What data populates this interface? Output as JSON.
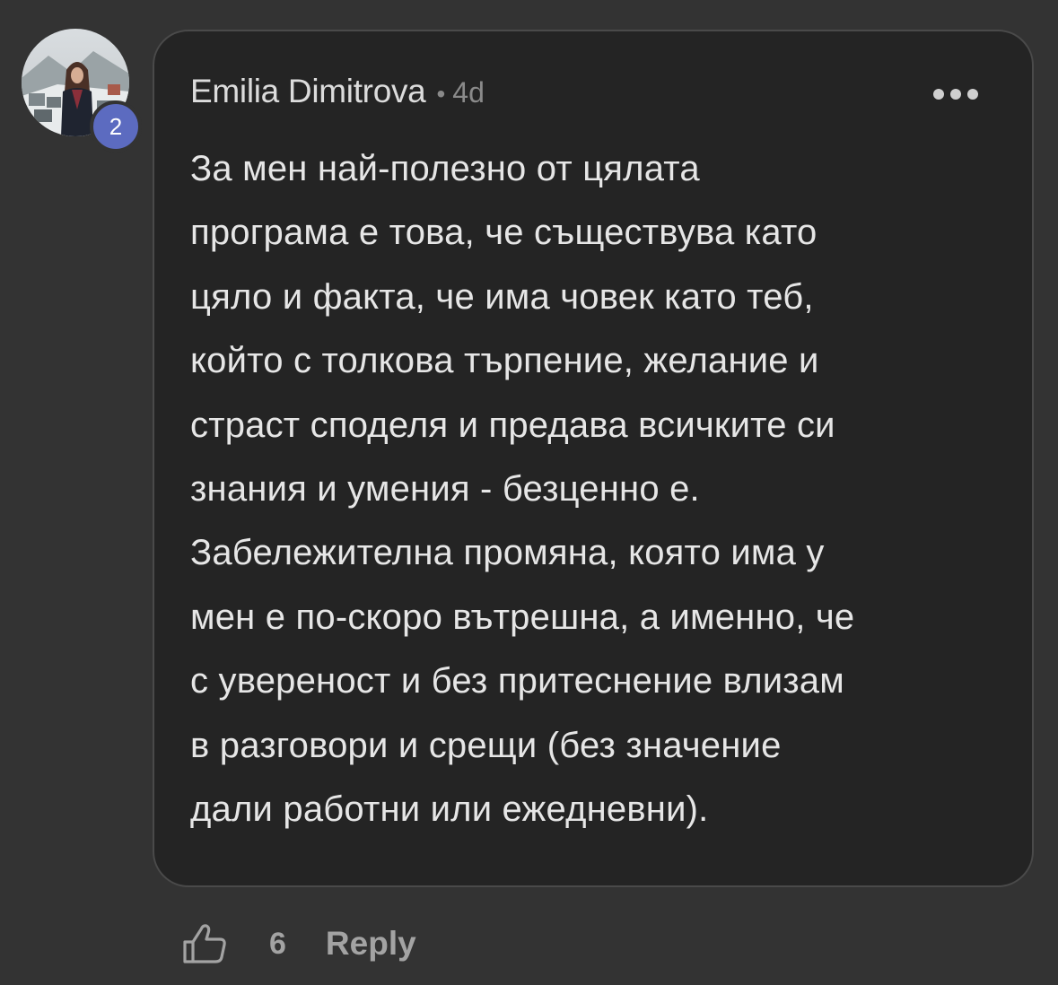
{
  "comment": {
    "author_name": "Emilia Dimitrova",
    "separator": "•",
    "time_ago": "4d",
    "author_level": "2",
    "text": "За мен най-полезно от цялата\nпрограма е това, че съществува като\nцяло и факта, че има човек като теб,\nкойто с толкова търпение, желание и\nстраст споделя и предава всичките си\nзнания и умения - безценно е.\nЗабележителна промяна, която има у\nмен е по-скоро вътрешна, а именно, че\nс увереност и без притеснение влизам\nв разговори и срещи (без значение\nдали работни или ежедневни).",
    "more_icon": "more-horizontal-icon"
  },
  "actions": {
    "like_icon": "thumbs-up-icon",
    "like_count": "6",
    "reply_label": "Reply"
  },
  "colors": {
    "background": "#333333",
    "card_background": "#242424",
    "card_border": "#4a4a4a",
    "badge": "#5c6bc0",
    "text_primary": "#e6e6e6",
    "text_secondary": "#8a8a8a"
  }
}
